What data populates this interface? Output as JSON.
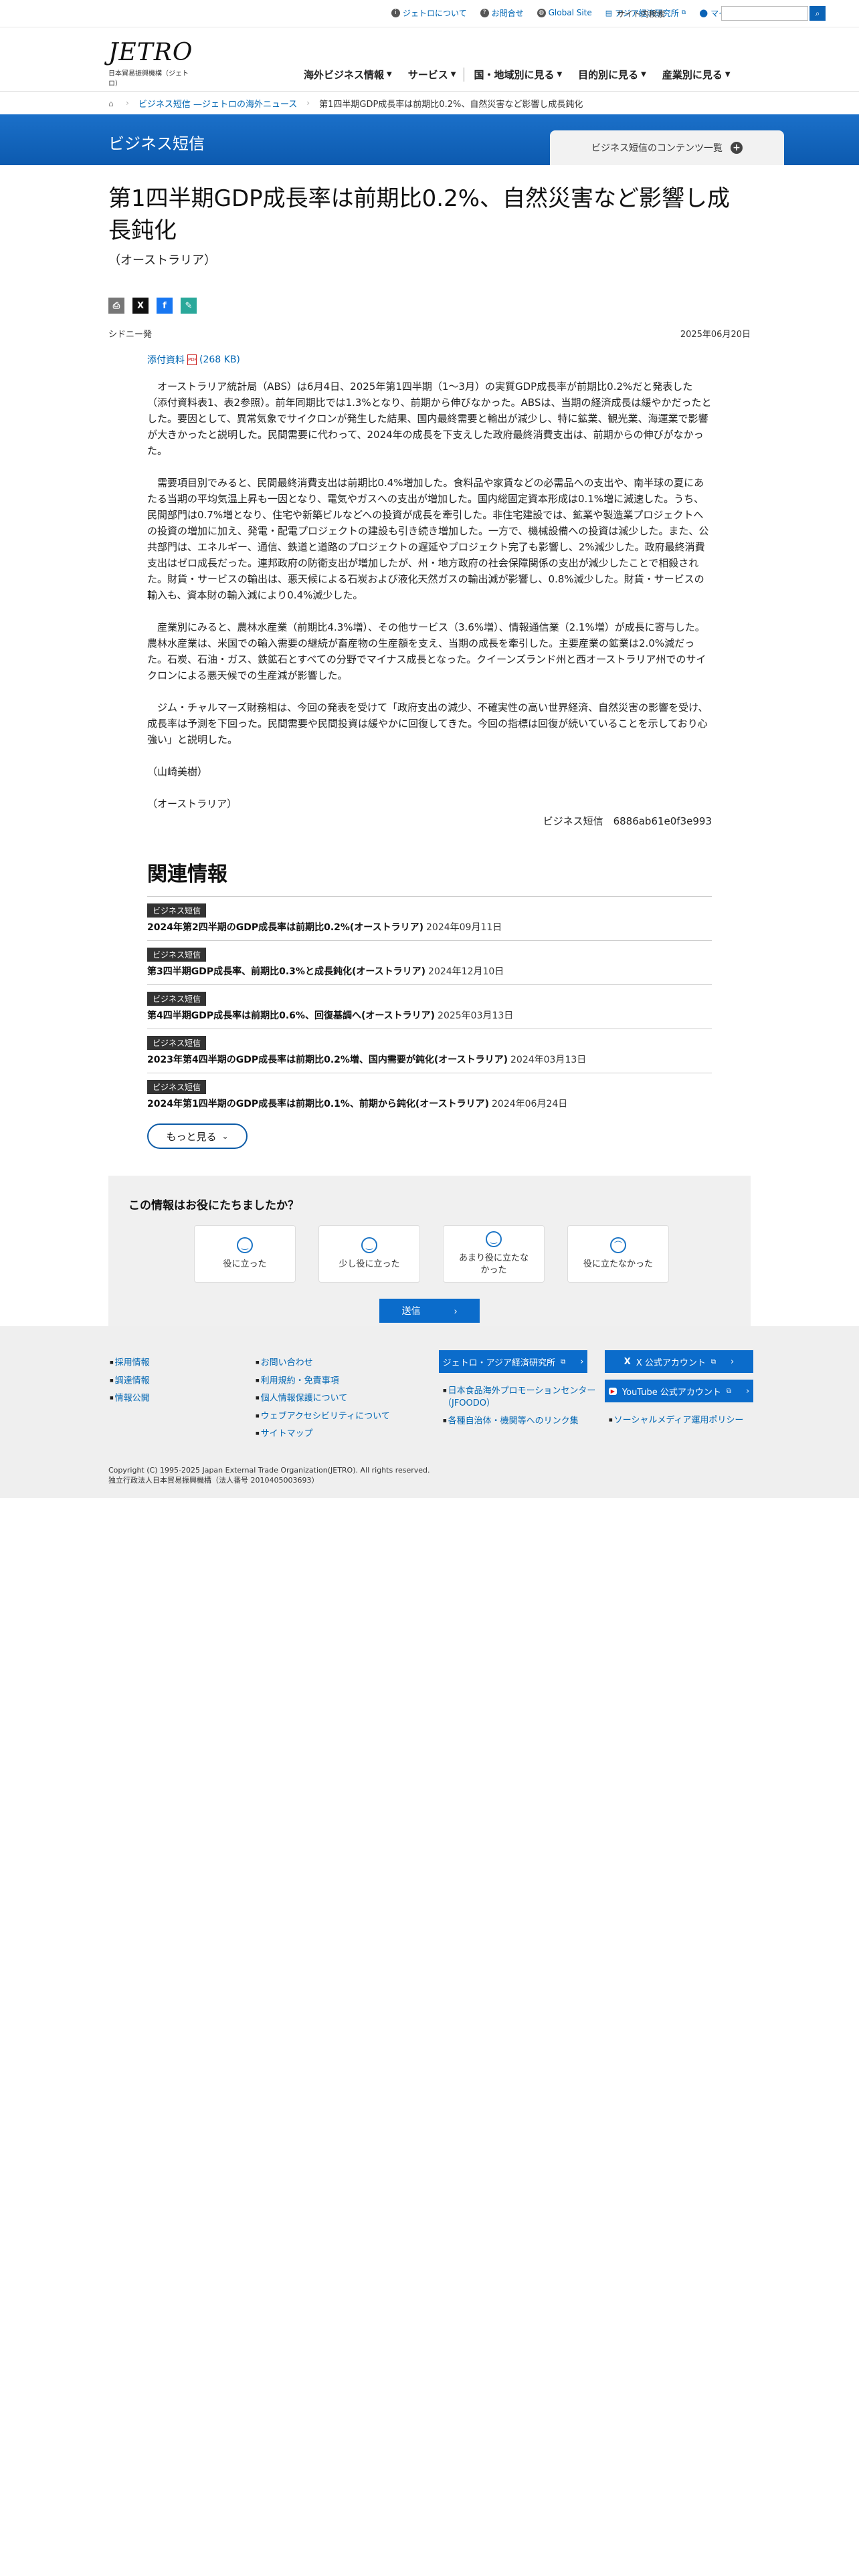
{
  "topbar": {
    "links": [
      "ジェトロについて",
      "お問合せ",
      "Global Site",
      "アジア経済研究所",
      "マイページ"
    ],
    "search_label": "サイト内検索",
    "search_placeholder": ""
  },
  "header": {
    "logo_main": "JETRO",
    "logo_sub": "日本貿易振興機構（ジェトロ）",
    "nav": [
      "海外ビジネス情報",
      "サービス",
      "国・地域別に見る",
      "目的別に見る",
      "産業別に見る"
    ]
  },
  "breadcrumb": [
    "ビジネス短信 —ジェトロの海外ニュース",
    "第1四半期GDP成長率は前期比0.2%、自然災害など影響し成長鈍化"
  ],
  "band": {
    "title": "ビジネス短信",
    "tab_label": "ビジネス短信のコンテンツ一覧"
  },
  "article": {
    "title": "第1四半期GDP成長率は前期比0.2%、自然災害など影響し成長鈍化",
    "country": "（オーストラリア）",
    "location": "シドニー発",
    "date": "2025年06月20日",
    "attachment": "添付資料",
    "attachment_size": "(268 KB)",
    "paragraphs": [
      "オーストラリア統計局（ABS）は6月4日、2025年第1四半期（1～3月）の実質GDP成長率が前期比0.2%だと発表した（添付資料表1、表2参照）。前年同期比では1.3%となり、前期から伸びなかった。ABSは、当期の経済成長は緩やかだったとした。要因として、異常気象でサイクロンが発生した結果、国内最終需要と輸出が減少し、特に鉱業、観光業、海運業で影響が大きかったと説明した。民間需要に代わって、2024年の成長を下支えした政府最終消費支出は、前期からの伸びがなかった。",
      "需要項目別でみると、民間最終消費支出は前期比0.4%増加した。食料品や家賃などの必需品への支出や、南半球の夏にあたる当期の平均気温上昇も一因となり、電気やガスへの支出が増加した。国内総固定資本形成は0.1%増に減速した。うち、民間部門は0.7%増となり、住宅や新築ビルなどへの投資が成長を牽引した。非住宅建設では、鉱業や製造業プロジェクトへの投資の増加に加え、発電・配電プロジェクトの建設も引き続き増加した。一方で、機械設備への投資は減少した。また、公共部門は、エネルギー、通信、鉄道と道路のプロジェクトの遅延やプロジェクト完了も影響し、2%減少した。政府最終消費支出はゼロ成長だった。連邦政府の防衛支出が増加したが、州・地方政府の社会保障関係の支出が減少したことで相殺された。財貨・サービスの輸出は、悪天候による石炭および液化天然ガスの輸出減が影響し、0.8%減少した。財貨・サービスの輸入も、資本財の輸入減により0.4%減少した。",
      "産業別にみると、農林水産業（前期比4.3%増）、その他サービス（3.6%増）、情報通信業（2.1%増）が成長に寄与した。農林水産業は、米国での輸入需要の継続が畜産物の生産額を支え、当期の成長を牽引した。主要産業の鉱業は2.0%減だった。石炭、石油・ガス、鉄鉱石とすべての分野でマイナス成長となった。クイーンズランド州と西オーストラリア州でのサイクロンによる悪天候での生産減が影響した。",
      "ジム・チャルマーズ財務相は、今回の発表を受けて「政府支出の減少、不確実性の高い世界経済、自然災害の影響を受け、成長率は予測を下回った。民間需要や民間投資は緩やかに回復してきた。今回の指標は回復が続いていることを示しており心強い」と説明した。"
    ],
    "author": "（山崎美樹）",
    "country_tag": "（オーストラリア）",
    "article_id": "ビジネス短信　6886ab61e0f3e993"
  },
  "related": {
    "heading": "関連情報",
    "items": [
      {
        "badge": "ビジネス短信",
        "title": "2024年第2四半期のGDP成長率は前期比0.2%(オーストラリア)",
        "date": "2024年09月11日"
      },
      {
        "badge": "ビジネス短信",
        "title": "第3四半期GDP成長率、前期比0.3%と成長鈍化(オーストラリア)",
        "date": "2024年12月10日"
      },
      {
        "badge": "ビジネス短信",
        "title": "第4四半期GDP成長率は前期比0.6%、回復基調へ(オーストラリア)",
        "date": "2025年03月13日"
      },
      {
        "badge": "ビジネス短信",
        "title": "2023年第4四半期のGDP成長率は前期比0.2%増、国内需要が鈍化(オーストラリア)",
        "date": "2024年03月13日"
      },
      {
        "badge": "ビジネス短信",
        "title": "2024年第1四半期のGDP成長率は前期比0.1%、前期から鈍化(オーストラリア)",
        "date": "2024年06月24日"
      }
    ],
    "more_label": "もっと見る"
  },
  "feedback": {
    "question": "この情報はお役にたちましたか？",
    "options": [
      "役に立った",
      "少し役に立った",
      "あまり役に立たなかった",
      "役に立たなかった"
    ],
    "send_label": "送信"
  },
  "footer": {
    "col1": [
      "採用情報",
      "調達情報",
      "情報公開"
    ],
    "col2": [
      "お問い合わせ",
      "利用規約・免責事項",
      "個人情報保護について",
      "ウェブアクセシビリティについて",
      "サイトマップ"
    ],
    "ide_button": "ジェトロ・アジア経済研究所",
    "col3": [
      "日本食品海外プロモーションセンター（JFOODO）",
      "各種自治体・機関等へのリンク集"
    ],
    "x_button": "X 公式アカウント",
    "yt_button": "YouTube 公式アカウント",
    "col4": [
      "ソーシャルメディア運用ポリシー"
    ],
    "copyright": "Copyright (C) 1995-2025 Japan External Trade Organization(JETRO). All rights reserved.",
    "corp": "独立行政法人日本貿易振興機構（法人番号 2010405003693）"
  },
  "colors": {
    "primary": "#0b6ccb",
    "band": "#1466bd",
    "footer_bg": "#efefef"
  }
}
